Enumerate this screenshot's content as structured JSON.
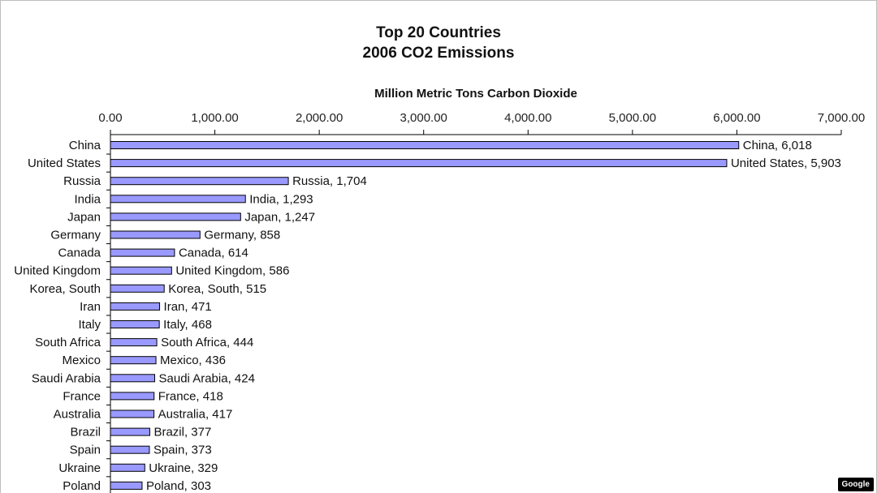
{
  "chart_data": {
    "type": "bar",
    "orientation": "horizontal",
    "title": [
      "Top 20 Countries",
      "2006 CO2 Emissions"
    ],
    "xlabel": "Million Metric Tons Carbon Dioxide",
    "xlim": [
      0,
      7000
    ],
    "xticks": [
      "0.00",
      "1,000.00",
      "2,000.00",
      "3,000.00",
      "4,000.00",
      "5,000.00",
      "6,000.00",
      "7,000.00"
    ],
    "xtick_values": [
      0,
      1000,
      2000,
      3000,
      4000,
      5000,
      6000,
      7000
    ],
    "x_axis_position": "top",
    "grid": false,
    "legend": "none",
    "bar_color": "#9999ff",
    "categories": [
      "China",
      "United States",
      "Russia",
      "India",
      "Japan",
      "Germany",
      "Canada",
      "United Kingdom",
      "Korea, South",
      "Iran",
      "Italy",
      "South Africa",
      "Mexico",
      "Saudi Arabia",
      "France",
      "Australia",
      "Brazil",
      "Spain",
      "Ukraine",
      "Poland"
    ],
    "values": [
      6018,
      5903,
      1704,
      1293,
      1247,
      858,
      614,
      586,
      515,
      471,
      468,
      444,
      436,
      424,
      418,
      417,
      377,
      373,
      329,
      303
    ],
    "data_labels": [
      "China, 6,018",
      "United States, 5,903",
      "Russia, 1,704",
      "India, 1,293",
      "Japan, 1,247",
      "Germany, 858",
      "Canada, 614",
      "United Kingdom, 586",
      "Korea, South, 515",
      "Iran, 471",
      "Italy, 468",
      "South Africa, 444",
      "Mexico, 436",
      "Saudi Arabia, 424",
      "France, 418",
      "Australia, 417",
      "Brazil, 377",
      "Spain, 373",
      "Ukraine, 329",
      "Poland, 303"
    ]
  },
  "watermark": "Google"
}
